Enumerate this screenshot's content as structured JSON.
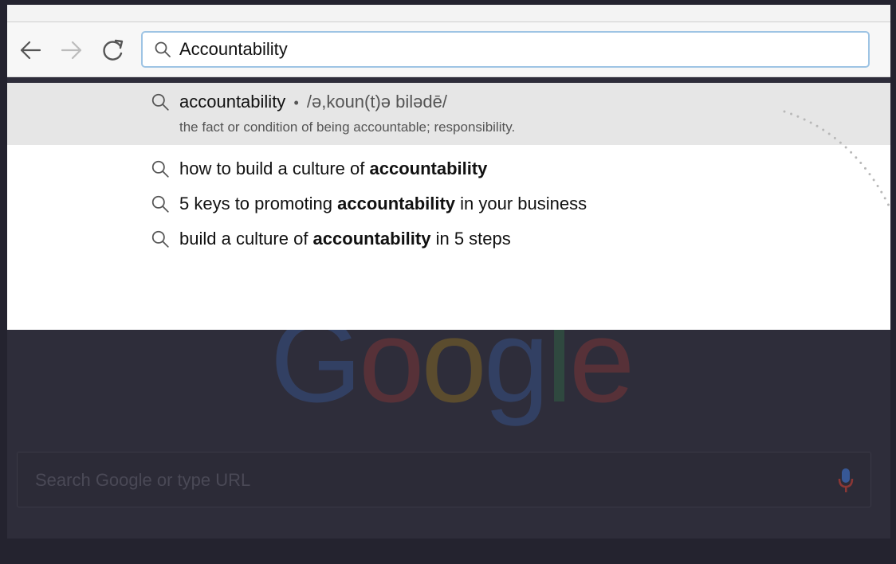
{
  "toolbar": {
    "back_icon": "back-arrow-icon",
    "forward_icon": "forward-arrow-icon",
    "reload_icon": "reload-icon"
  },
  "omnibox": {
    "value": "Accountability",
    "icon": "search-icon"
  },
  "dropdown": {
    "top_suggestion": {
      "word": "accountability",
      "bullet": "•",
      "pronunciation": "/ə,koun(t)ə bilədē/",
      "definition": "the fact or condition of being accountable; responsibility."
    },
    "suggestions": [
      {
        "before": "how to build a culture of ",
        "bold": "accountability",
        "after": ""
      },
      {
        "before": "5 keys to promoting ",
        "bold": "accountability",
        "after": " in your business"
      },
      {
        "before": "build a culture of ",
        "bold": "accountability",
        "after": " in 5 steps"
      }
    ]
  },
  "background_page": {
    "logo_text": "Google",
    "search_placeholder": "Search Google or type URL",
    "mic_icon": "microphone-icon"
  },
  "colors": {
    "overlay_bg": "#24232f",
    "omnibox_focus": "#9ec4e4",
    "highlight_row": "#e6e6e6"
  }
}
